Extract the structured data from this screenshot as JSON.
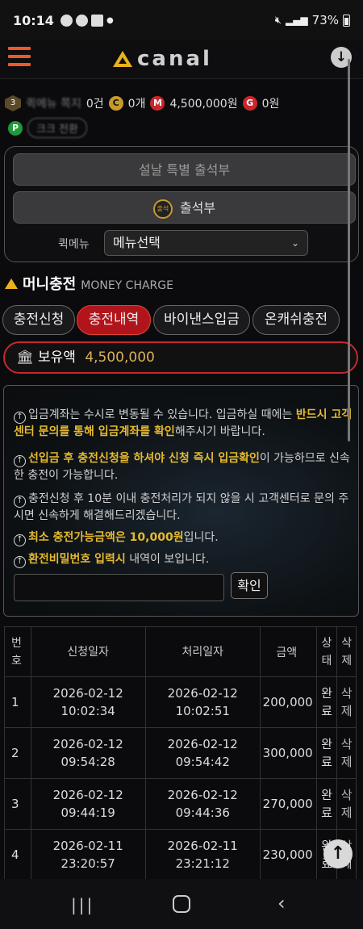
{
  "status_bar": {
    "time": "10:14",
    "battery": "73%"
  },
  "header": {
    "logo_text": "canal"
  },
  "info": {
    "blurred_menu": "퀵메뉴 쪽지",
    "notes": "0건",
    "coin": "0개",
    "money": "4,500,000원",
    "g_points": "0원",
    "row2_blurred": "크크 전환",
    "level": "3"
  },
  "menu": {
    "special_attendance": "설날 특별 출석부",
    "attendance": "출석부",
    "attendance_icon_text": "출석",
    "quick_label": "퀵메뉴",
    "quick_select": "메뉴선택"
  },
  "section": {
    "title": "머니충전",
    "subtitle": "MONEY CHARGE"
  },
  "tabs": [
    "충전신청",
    "충전내역",
    "바이낸스입금",
    "온캐쉬충전"
  ],
  "balance": {
    "label": "보유액",
    "value": "4,500,000"
  },
  "notice": {
    "n1_a": "입금계좌는 수시로 변동될 수 있습니다. 입금하실 때에는 ",
    "n1_hl": "반드시 고객센터 문의를 통해 입금계좌를 확인",
    "n1_b": "해주시기 바랍니다.",
    "n2_hl": "선입금 후 충전신청을 하셔야 신청 즉시 입금확인",
    "n2_b": "이 가능하므로 신속한 충전이 가능합니다.",
    "n3": "충전신청 후 10분 이내 충전처리가 되지 않을 시 고객센터로 문의 주시면 신속하게 해결해드리겠습니다.",
    "n4_hl": "최소 충전가능금액은 10,000원",
    "n4_b": "입니다.",
    "n5_hl": "환전비밀번호 입력시",
    "n5_b": " 내역이 보입니다.",
    "confirm": "확인"
  },
  "table": {
    "headers": {
      "no_1": "번",
      "no_2": "호",
      "req_date": "신청일자",
      "proc_date": "처리일자",
      "amount": "금액",
      "status_1": "상",
      "status_2": "태",
      "delete_1": "삭",
      "delete_2": "제"
    },
    "rows": [
      {
        "no": "1",
        "req_d": "2026-02-12",
        "req_t": "10:02:34",
        "proc_d": "2026-02-12",
        "proc_t": "10:02:51",
        "amount": "200,000",
        "st1": "완",
        "st2": "료",
        "del1": "삭",
        "del2": "제"
      },
      {
        "no": "2",
        "req_d": "2026-02-12",
        "req_t": "09:54:28",
        "proc_d": "2026-02-12",
        "proc_t": "09:54:42",
        "amount": "300,000",
        "st1": "완",
        "st2": "료",
        "del1": "삭",
        "del2": "제"
      },
      {
        "no": "3",
        "req_d": "2026-02-12",
        "req_t": "09:44:19",
        "proc_d": "2026-02-12",
        "proc_t": "09:44:36",
        "amount": "270,000",
        "st1": "완",
        "st2": "료",
        "del1": "삭",
        "del2": "제"
      },
      {
        "no": "4",
        "req_d": "2026-02-11",
        "req_t": "23:20:57",
        "proc_d": "2026-02-11",
        "proc_t": "23:21:12",
        "amount": "230,000",
        "st1": "완",
        "st2": "료",
        "del1": "삭",
        "del2": "제"
      }
    ]
  },
  "colors": {
    "accent": "#b1151b",
    "gold": "#e5b930",
    "logo": "#e9b31c",
    "menu_icon": "#f05a22"
  }
}
